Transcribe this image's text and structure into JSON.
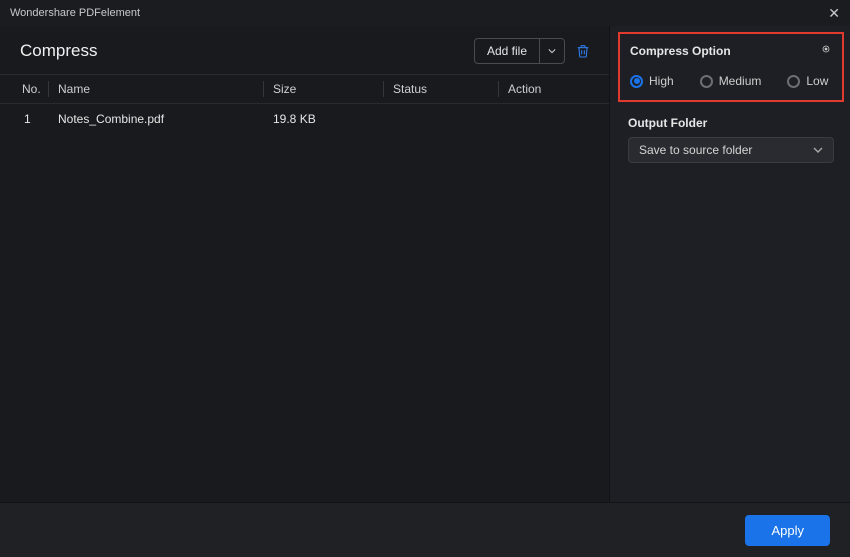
{
  "app": {
    "title": "Wondershare PDFelement"
  },
  "page": {
    "title": "Compress"
  },
  "toolbar": {
    "add_file_label": "Add file"
  },
  "columns": {
    "no": "No.",
    "name": "Name",
    "size": "Size",
    "status": "Status",
    "action": "Action"
  },
  "rows": [
    {
      "no": "1",
      "name": "Notes_Combine.pdf",
      "size": "19.8 KB",
      "status": "",
      "action": ""
    }
  ],
  "compress_option": {
    "title": "Compress Option",
    "high": "High",
    "medium": "Medium",
    "low": "Low",
    "selected": "high"
  },
  "output_folder": {
    "label": "Output Folder",
    "value": "Save to source folder"
  },
  "footer": {
    "apply_label": "Apply"
  }
}
